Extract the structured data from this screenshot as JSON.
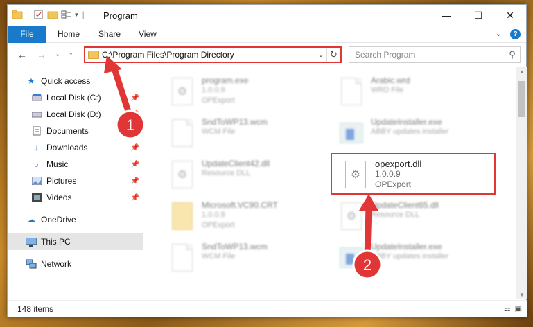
{
  "window": {
    "title": "Program",
    "minimize": "—",
    "maximize": "☐",
    "close": "✕"
  },
  "ribbon": {
    "tabs": [
      "File",
      "Home",
      "Share",
      "View"
    ],
    "expand": "⌄",
    "help": "?"
  },
  "navigation": {
    "back": "←",
    "forward": "→",
    "recent": "⌄",
    "up": "↑",
    "address_path": "C:\\Program Files\\Program Directory",
    "address_dropdown": "⌄",
    "refresh": "↻",
    "search_placeholder": "Search Program",
    "search_icon": "⚲"
  },
  "sidebar": {
    "items": [
      {
        "label": "Quick access",
        "icon": "star-icon",
        "pinned": false
      },
      {
        "label": "Local Disk (C:)",
        "icon": "drive-icon",
        "pinned": true
      },
      {
        "label": "Local Disk (D:)",
        "icon": "drive-icon",
        "pinned": true
      },
      {
        "label": "Documents",
        "icon": "documents-icon",
        "pinned": true
      },
      {
        "label": "Downloads",
        "icon": "download-icon",
        "pinned": true
      },
      {
        "label": "Music",
        "icon": "music-icon",
        "pinned": true
      },
      {
        "label": "Pictures",
        "icon": "pictures-icon",
        "pinned": true
      },
      {
        "label": "Videos",
        "icon": "videos-icon",
        "pinned": true
      },
      {
        "label": "OneDrive",
        "icon": "cloud-icon",
        "pinned": false
      },
      {
        "label": "This PC",
        "icon": "computer-icon",
        "pinned": false,
        "selected": true
      },
      {
        "label": "Network",
        "icon": "network-icon",
        "pinned": false
      }
    ],
    "pin_glyph": "📌"
  },
  "files": [
    {
      "name": "program.exe",
      "line2": "1.0.0.9",
      "line3": "OPExport",
      "icon": "program-icon"
    },
    {
      "name": "Arabic.wrd",
      "line2": "WRD File",
      "line3": "",
      "icon": "document-icon"
    },
    {
      "name": "SndToWP13.wcm",
      "line2": "WCM File",
      "line3": "",
      "icon": "document-icon"
    },
    {
      "name": "UpdateInstaller.exe",
      "line2": "ABBY updates installer",
      "line3": "",
      "icon": "installer-icon"
    },
    {
      "name": "UpdateClient42.dll",
      "line2": "Resource DLL",
      "line3": "",
      "icon": "dll-icon"
    },
    {
      "name": "opexport.dll",
      "line2": "1.0.0.9",
      "line3": "OPExport",
      "icon": "dll-icon"
    },
    {
      "name": "Microsoft.VC90.CRT",
      "line2": "1.0.0.9",
      "line3": "OPExport",
      "icon": "folder-icon"
    },
    {
      "name": "UpdateClient65.dll",
      "line2": "Resource DLL",
      "line3": "",
      "icon": "dll-icon"
    },
    {
      "name": "SndToWP13.wcm",
      "line2": "WCM File",
      "line3": "",
      "icon": "document-icon"
    },
    {
      "name": "UpdateInstaller.exe",
      "line2": "ABBY updates installer",
      "line3": "",
      "icon": "installer-icon"
    }
  ],
  "status": {
    "items_count": "148 items"
  },
  "annotations": [
    {
      "number": "1",
      "color": "#e03636"
    },
    {
      "number": "2",
      "color": "#e03636"
    }
  ],
  "colors": {
    "accent": "#1979ca",
    "annotation": "#e03636"
  }
}
